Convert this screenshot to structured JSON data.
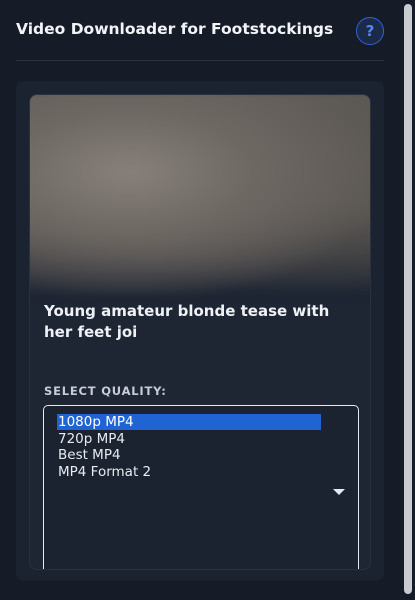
{
  "header": {
    "title": "Video Downloader for Footstockings",
    "help_label": "?"
  },
  "video": {
    "title": "Young amateur blonde tease with her feet joi"
  },
  "quality": {
    "label": "SELECT QUALITY:",
    "options": [
      "1080p MP4",
      "720p MP4",
      "Best MP4",
      "MP4 Format 2"
    ],
    "selected": "1080p MP4"
  },
  "colors": {
    "background": "#151b27",
    "accent": "#1f64d2",
    "help_border": "#2f63d6"
  },
  "icons": {
    "help": "question-mark-icon",
    "dropdown": "chevron-down-icon"
  }
}
